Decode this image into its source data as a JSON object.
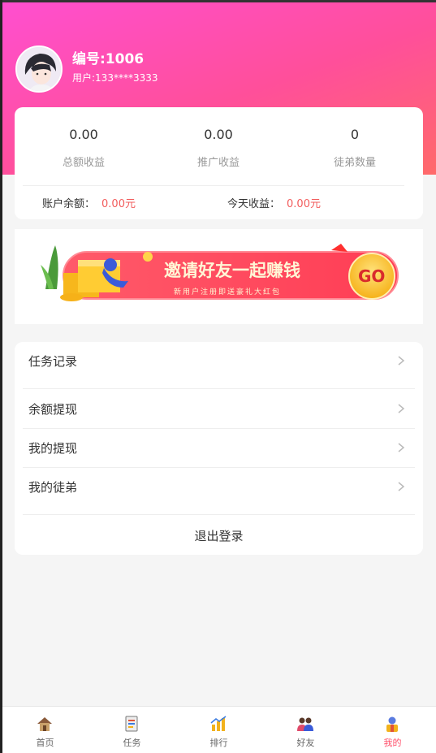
{
  "profile": {
    "id_label": "编号:1006",
    "phone_label": "用户:133****3333"
  },
  "stats": {
    "total_value": "0.00",
    "total_label": "总额收益",
    "promo_value": "0.00",
    "promo_label": "推广收益",
    "disciples_value": "0",
    "disciples_label": "徒弟数量",
    "balance_label": "账户余额：",
    "balance_value": "0.00元",
    "today_label": "今天收益：",
    "today_value": "0.00元"
  },
  "banner": {
    "headline": "邀请好友一起赚钱",
    "subline": "新用户注册即送豪礼大红包",
    "cta": "GO"
  },
  "menu": {
    "items": [
      {
        "label": "任务记录"
      },
      {
        "label": "余额提现"
      },
      {
        "label": "我的提现"
      },
      {
        "label": "我的徒弟"
      }
    ],
    "logout_label": "退出登录"
  },
  "tabs": [
    {
      "label": "首页",
      "icon": "home-icon"
    },
    {
      "label": "任务",
      "icon": "task-icon"
    },
    {
      "label": "排行",
      "icon": "ranking-icon"
    },
    {
      "label": "好友",
      "icon": "friends-icon"
    },
    {
      "label": "我的",
      "icon": "profile-icon",
      "active": true
    }
  ],
  "colors": {
    "accent": "#ff4f9a",
    "amount": "#f25c5c",
    "tab_active": "#ff4f6a"
  }
}
